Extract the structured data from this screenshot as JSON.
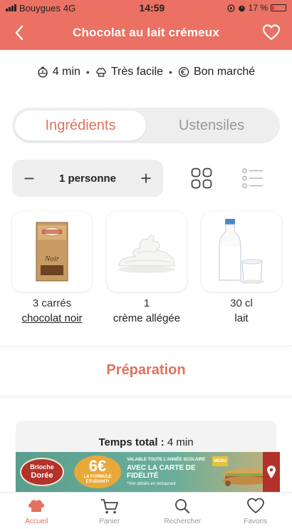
{
  "status_bar": {
    "carrier": "Bouygues",
    "network": "4G",
    "time": "14:59",
    "battery": "17 %",
    "battery_level": 0.17
  },
  "header": {
    "title": "Chocolat au lait crémeux",
    "back_icon": "chevron-left-icon",
    "favorite_icon": "heart-outline-icon",
    "background": "#ea7163"
  },
  "meta": {
    "time": "4 min",
    "difficulty": "Très facile",
    "cost": "Bon marché"
  },
  "tabs": {
    "ingredients": "Ingrédients",
    "utensils": "Ustensiles",
    "active": "ingredients"
  },
  "portions": {
    "minus": "−",
    "label": "1 personne",
    "plus": "+"
  },
  "ingredients": [
    {
      "quantity": "3 carrés",
      "name": "chocolat noir",
      "image": "chocolate-bar"
    },
    {
      "quantity": "1",
      "name": "crème allégée",
      "image": "whipped-cream"
    },
    {
      "quantity": "30 cl",
      "name": "lait",
      "image": "milk-bottle"
    }
  ],
  "preparation": {
    "title": "Préparation",
    "total_time_label": "Temps total :",
    "total_time_value": "4 min"
  },
  "ad": {
    "brand_line1": "Brioche",
    "brand_line2": "Dorée",
    "price": "6€",
    "price_sub1": "LA FORMULE",
    "price_sub2": "ÉTUDIANT*",
    "line1": "VALABLE TOUTE L'ANNÉE SCOLAIRE",
    "line2": "AVEC LA CARTE DE FIDÉLITÉ",
    "line3": "*Voir détails en restaurant",
    "tag": "MENU"
  },
  "nav": [
    {
      "label": "Accueil",
      "icon": "chef-hat-icon",
      "active": true
    },
    {
      "label": "Panier",
      "icon": "cart-icon",
      "active": false
    },
    {
      "label": "Rechercher",
      "icon": "search-icon",
      "active": false
    },
    {
      "label": "Favoris",
      "icon": "heart-icon",
      "active": false
    }
  ],
  "colors": {
    "accent": "#e0725f",
    "header": "#ea7163",
    "inactive": "#999999"
  }
}
